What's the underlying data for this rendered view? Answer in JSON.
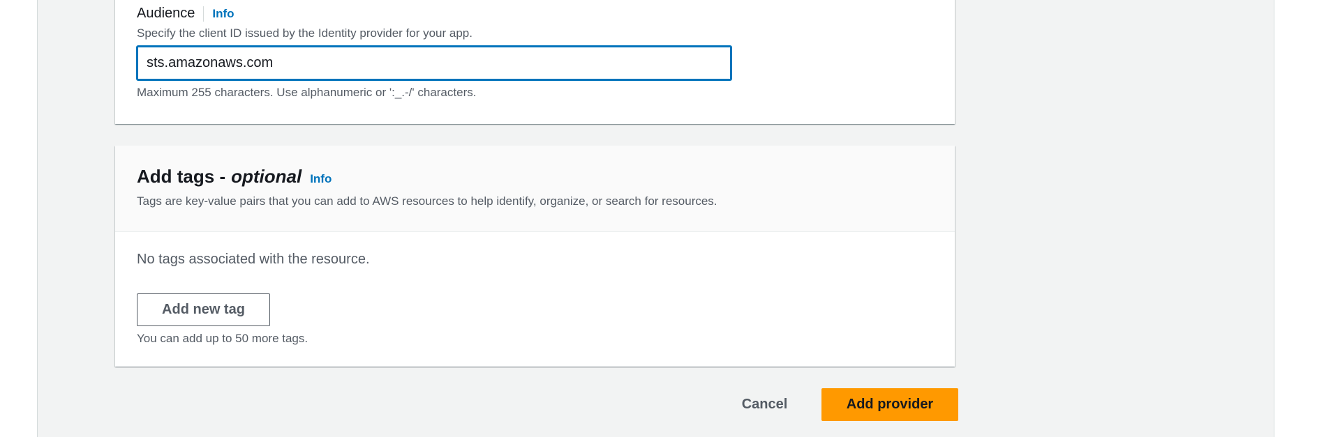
{
  "audience": {
    "label": "Audience",
    "info_label": "Info",
    "description": "Specify the client ID issued by the Identity provider for your app.",
    "value": "sts.amazonaws.com",
    "constraint": "Maximum 255 characters. Use alphanumeric or ':_.-/' characters."
  },
  "tags": {
    "title": "Add tags -",
    "title_optional": "optional",
    "info_label": "Info",
    "description": "Tags are key-value pairs that you can add to AWS resources to help identify, organize, or search for resources.",
    "empty_text": "No tags associated with the resource.",
    "add_button_label": "Add new tag",
    "limit_text": "You can add up to 50 more tags."
  },
  "actions": {
    "cancel_label": "Cancel",
    "submit_label": "Add provider"
  },
  "colors": {
    "link": "#0073bb",
    "primary_button": "#ff9900",
    "focus_border": "#0073bb",
    "page_background": "#f2f3f3"
  }
}
